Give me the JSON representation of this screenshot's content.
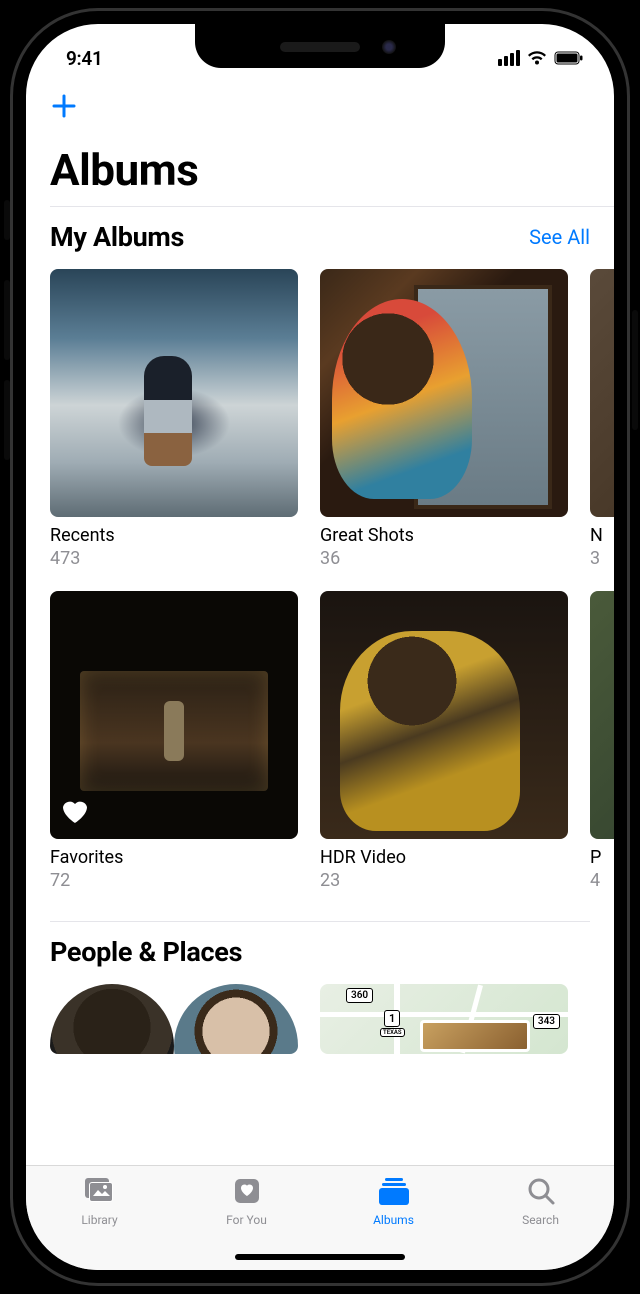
{
  "status": {
    "time": "9:41"
  },
  "header": {
    "title": "Albums"
  },
  "sections": {
    "my_albums": {
      "title": "My Albums",
      "see_all": "See All"
    },
    "people_places": {
      "title": "People & Places"
    }
  },
  "albums": [
    {
      "name": "Recents",
      "count": "473"
    },
    {
      "name": "Great Shots",
      "count": "36"
    },
    {
      "name": "N",
      "count": "3"
    },
    {
      "name": "Favorites",
      "count": "72"
    },
    {
      "name": "HDR Video",
      "count": "23"
    },
    {
      "name": "P",
      "count": "4"
    }
  ],
  "map_shields": [
    "360",
    "1",
    "343"
  ],
  "map_label": "TEXAS",
  "tabs": {
    "library": "Library",
    "for_you": "For You",
    "albums": "Albums",
    "search": "Search"
  }
}
